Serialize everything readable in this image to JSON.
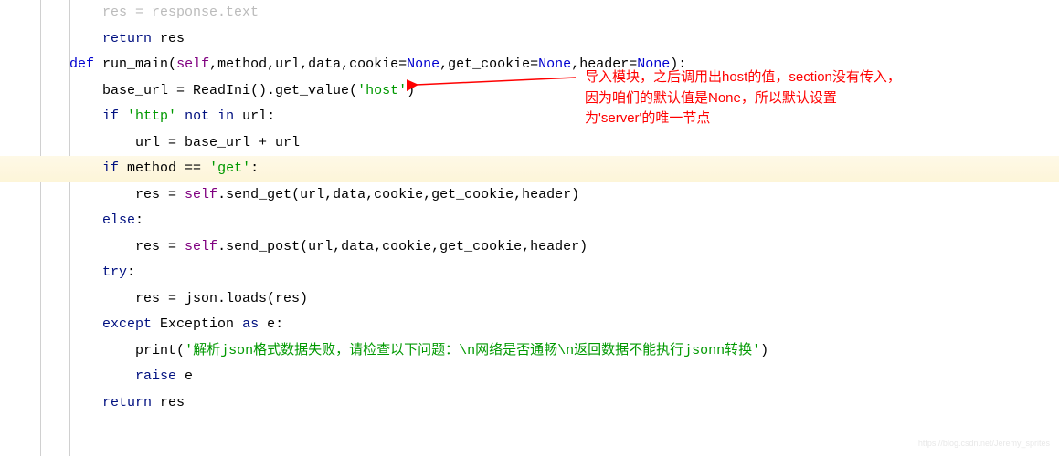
{
  "code": {
    "l0_p1": "res = response.text",
    "l1_kw": "return",
    "l1_rest": " res",
    "l2_def": "def",
    "l2_fn": " run_main",
    "l2_open": "(",
    "l2_self": "self",
    "l2_c1": ",method,url,data,cookie=",
    "l2_none1": "None",
    "l2_c2": ",get_cookie=",
    "l2_none2": "None",
    "l2_c3": ",header=",
    "l2_none3": "None",
    "l2_close": "):",
    "l3_p1": "base_url = ReadIni().get_value(",
    "l3_str": "'host'",
    "l3_p2": ")",
    "l4_kw": "if",
    "l4_p1": " ",
    "l4_str": "'http'",
    "l4_p2": " ",
    "l4_kw2": "not in",
    "l4_p3": " url:",
    "l5_p1": "url = base_url + url",
    "l6_kw": "if",
    "l6_p1": " method == ",
    "l6_str": "'get'",
    "l6_p2": ":",
    "l7_p1": "res = ",
    "l7_self": "self",
    "l7_p2": ".send_get(url,data,cookie,get_cookie,header)",
    "l8_kw": "else",
    "l8_p1": ":",
    "l9_p1": "res = ",
    "l9_self": "self",
    "l9_p2": ".send_post(url,data,cookie,get_cookie,header)",
    "l10_kw": "try",
    "l10_p1": ":",
    "l11_p1": "res = json.loads(res)",
    "l12_kw": "except",
    "l12_p1": " Exception ",
    "l12_kw2": "as",
    "l12_p2": " e:",
    "l13_fn": "print",
    "l13_p1": "(",
    "l13_str": "'解析json格式数据失败，请检查以下问题：\\n网络是否通畅\\n返回数据不能执行jsonn转换'",
    "l13_p2": ")",
    "l14_kw": "raise",
    "l14_p1": " e",
    "l15_kw": "return",
    "l15_p1": " res"
  },
  "annotation": {
    "line1": "导入模块，之后调用出host的值，section没有传入，",
    "line2": "因为咱们的默认值是None，所以默认设置",
    "line3": "为'server'的唯一节点"
  },
  "watermark": "https://blog.csdn.net/Jeremy_sprites"
}
